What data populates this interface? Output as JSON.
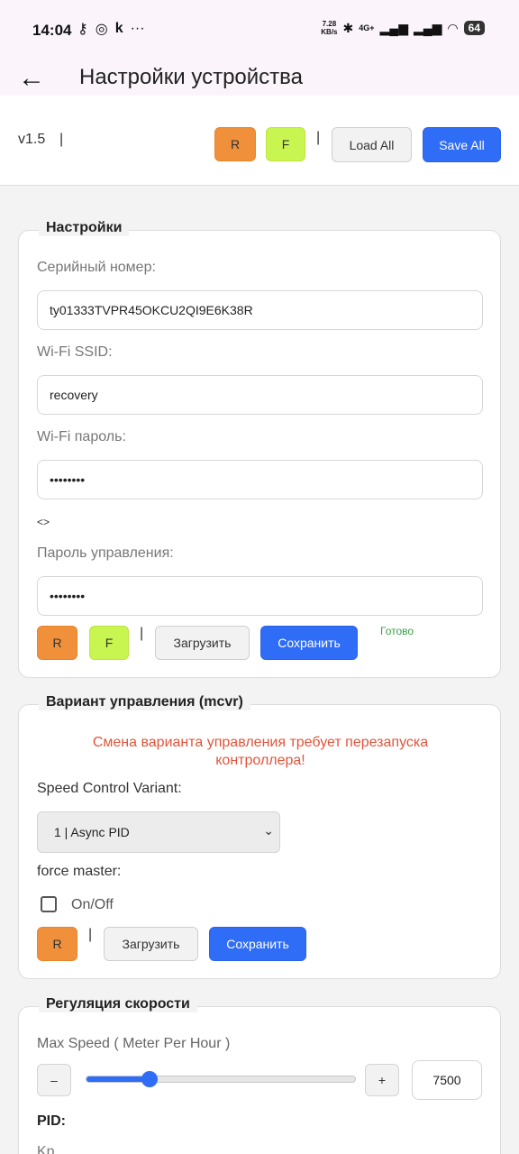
{
  "status_bar": {
    "time": "14:04",
    "left_icons": [
      "key-icon",
      "circle-icon",
      "k-icon",
      "more-icon"
    ],
    "net_speed_value": "7.28",
    "net_speed_unit": "KB/s",
    "network": "4G+",
    "battery": "64"
  },
  "app_bar": {
    "title": "Настройки устройства"
  },
  "toolbar": {
    "version": "v1.5",
    "sep": "|",
    "r_label": "R",
    "f_label": "F",
    "load_all": "Load All",
    "save_all": "Save All"
  },
  "settings": {
    "legend": "Настройки",
    "serial_label": "Серийный номер:",
    "serial_value": "ty01333TVPR45OKCU2QI9E6K38R",
    "ssid_label": "Wi-Fi SSID:",
    "ssid_value": "recovery",
    "wifi_pass_label": "Wi-Fi пароль:",
    "wifi_pass_value": "••••••••",
    "toggle_visibility": "<>",
    "ctrl_pass_label": "Пароль управления:",
    "ctrl_pass_value": "••••••••",
    "r_label": "R",
    "f_label": "F",
    "sep": "|",
    "load": "Загрузить",
    "save": "Сохранить",
    "status": "Готово"
  },
  "mcvr": {
    "legend": "Вариант управления (mcvr)",
    "warning": "Смена варианта управления требует перезапуска контроллера!",
    "variant_label": "Speed Control Variant:",
    "variant_value": "1 | Async PID",
    "force_label": "force master:",
    "checkbox_label": "On/Off",
    "checkbox_checked": false,
    "r_label": "R",
    "sep": "|",
    "load": "Загрузить",
    "save": "Сохранить"
  },
  "speed": {
    "legend": "Регуляция скорости",
    "max_speed_label": "Max Speed ( Meter Per Hour )",
    "minus": "–",
    "plus": "+",
    "slider_fraction": 0.235,
    "value": "7500",
    "pid_label": "PID:",
    "kp_label": "Kp"
  },
  "colors": {
    "orange": "#f0903a",
    "lime": "#c9f550",
    "blue": "#2f6df6",
    "warning": "#e0553c",
    "ok": "#3aa04a"
  }
}
